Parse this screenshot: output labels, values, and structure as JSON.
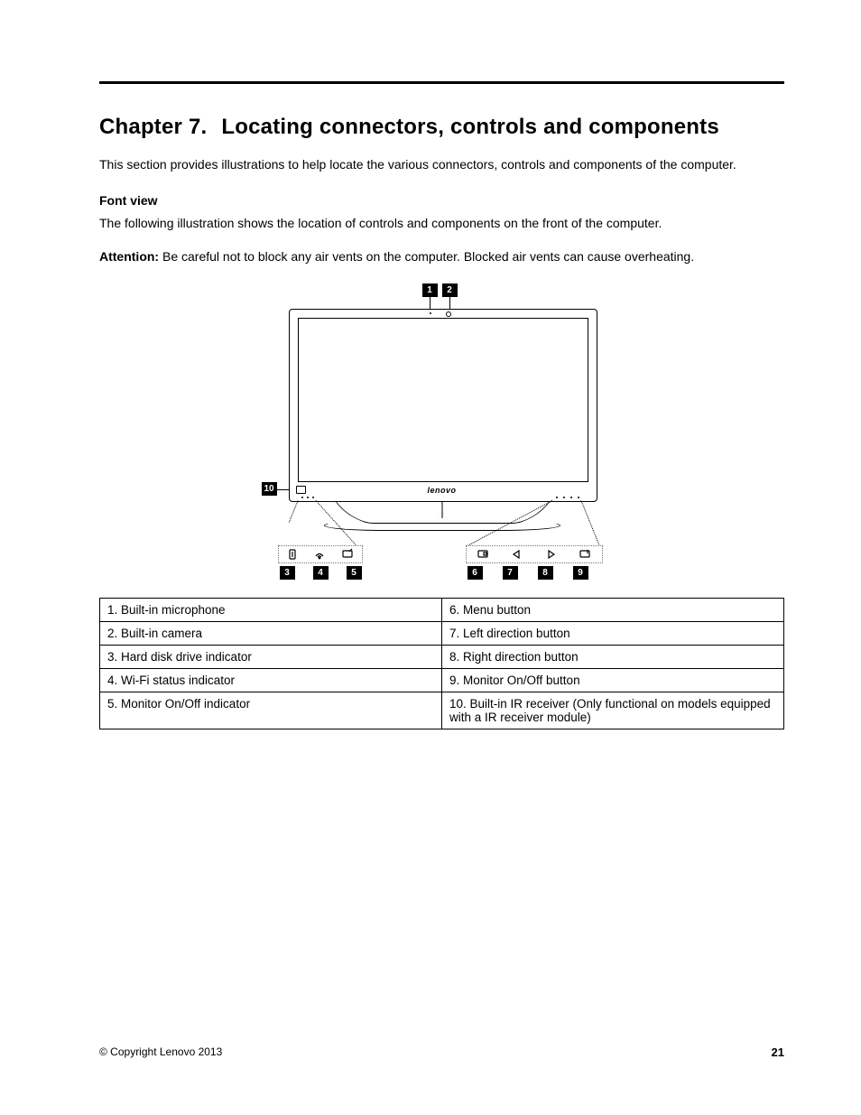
{
  "chapter": {
    "label": "Chapter 7.",
    "title": "Locating connectors, controls and components"
  },
  "intro": "This section provides illustrations to help locate the various connectors, controls and components of the computer.",
  "section_heading": "Font view",
  "section_intro": "The following illustration shows the location of controls and components on the front of the computer.",
  "attention_label": "Attention:",
  "attention_text": "Be careful not to block any air vents on the computer. Blocked air vents can cause overheating.",
  "figure": {
    "brand": "lenovo",
    "callouts_top": [
      "1",
      "2"
    ],
    "callout_side": "10",
    "callouts_bottom_left": [
      "3",
      "4",
      "5"
    ],
    "callouts_bottom_right": [
      "6",
      "7",
      "8",
      "9"
    ]
  },
  "legend_rows": [
    {
      "left": "1.  Built-in microphone",
      "right": "6.  Menu button"
    },
    {
      "left": "2.  Built-in camera",
      "right": "7.  Left direction button"
    },
    {
      "left": "3.  Hard disk drive indicator",
      "right": "8.  Right direction button"
    },
    {
      "left": "4.  Wi-Fi status indicator",
      "right": "9.  Monitor On/Off button"
    },
    {
      "left": "5.  Monitor On/Off indicator",
      "right": "10.  Built-in IR receiver (Only functional on models equipped with a IR receiver module)"
    }
  ],
  "footer": {
    "copyright": "© Copyright Lenovo 2013",
    "page": "21"
  }
}
